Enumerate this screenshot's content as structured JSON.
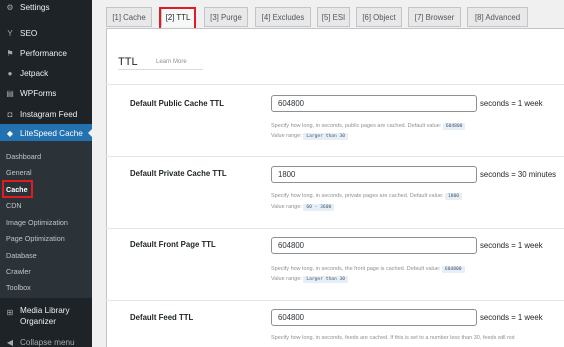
{
  "sidebar": {
    "items": [
      {
        "label": "Settings",
        "icon": "settings-icon",
        "glyph": "⚙"
      },
      {
        "label": "SEO",
        "icon": "seo-icon",
        "glyph": "Y"
      },
      {
        "label": "Performance",
        "icon": "performance-icon",
        "glyph": "⚑"
      },
      {
        "label": "Jetpack",
        "icon": "jetpack-icon",
        "glyph": "●"
      },
      {
        "label": "WPForms",
        "icon": "wpforms-icon",
        "glyph": "▤"
      },
      {
        "label": "Instagram Feed",
        "icon": "instagram-icon",
        "glyph": "◘"
      },
      {
        "label": "LiteSpeed Cache",
        "icon": "litespeed-icon",
        "glyph": "◆"
      }
    ],
    "submenu": [
      "Dashboard",
      "General",
      "Cache",
      "CDN",
      "Image Optimization",
      "Page Optimization",
      "Database",
      "Crawler",
      "Toolbox"
    ],
    "media_library": {
      "label": "Media Library Organizer",
      "icon": "media-library-icon",
      "glyph": "⊞"
    },
    "collapse": {
      "label": "Collapse menu",
      "icon": "collapse-icon",
      "glyph": "◀"
    }
  },
  "tabs": [
    "[1] Cache",
    "[2] TTL",
    "[3] Purge",
    "[4] Excludes",
    "[5] ESI",
    "[6] Object",
    "[7] Browser",
    "[8] Advanced"
  ],
  "section": {
    "title": "TTL",
    "learn_more": "Learn More"
  },
  "rows": [
    {
      "label": "Default Public Cache TTL",
      "value": "604800",
      "suffix": "seconds = 1 week",
      "desc": "Specify how long, in seconds, public pages are cached. Default value:",
      "default": "604800",
      "range_label": "Value range:",
      "range": "Larger than 30"
    },
    {
      "label": "Default Private Cache TTL",
      "value": "1800",
      "suffix": "seconds = 30 minutes",
      "desc": "Specify how long, in seconds, private pages are cached. Default value:",
      "default": "1800",
      "range_label": "Value range:",
      "range": "60 - 3600"
    },
    {
      "label": "Default Front Page TTL",
      "value": "604800",
      "suffix": "seconds = 1 week",
      "desc": "Specify how long, in seconds, the front page is cached. Default value:",
      "default": "604800",
      "range_label": "Value range:",
      "range": "Larger than 30"
    },
    {
      "label": "Default Feed TTL",
      "value": "604800",
      "suffix": "seconds = 1 week",
      "desc": "Specify how long, in seconds, feeds are cached. If this is set to a number less than 30, feeds will not"
    }
  ],
  "colors": {
    "highlight": "#e01b24",
    "active_menu": "#2271b1",
    "sidebar_bg": "#1d2327"
  }
}
